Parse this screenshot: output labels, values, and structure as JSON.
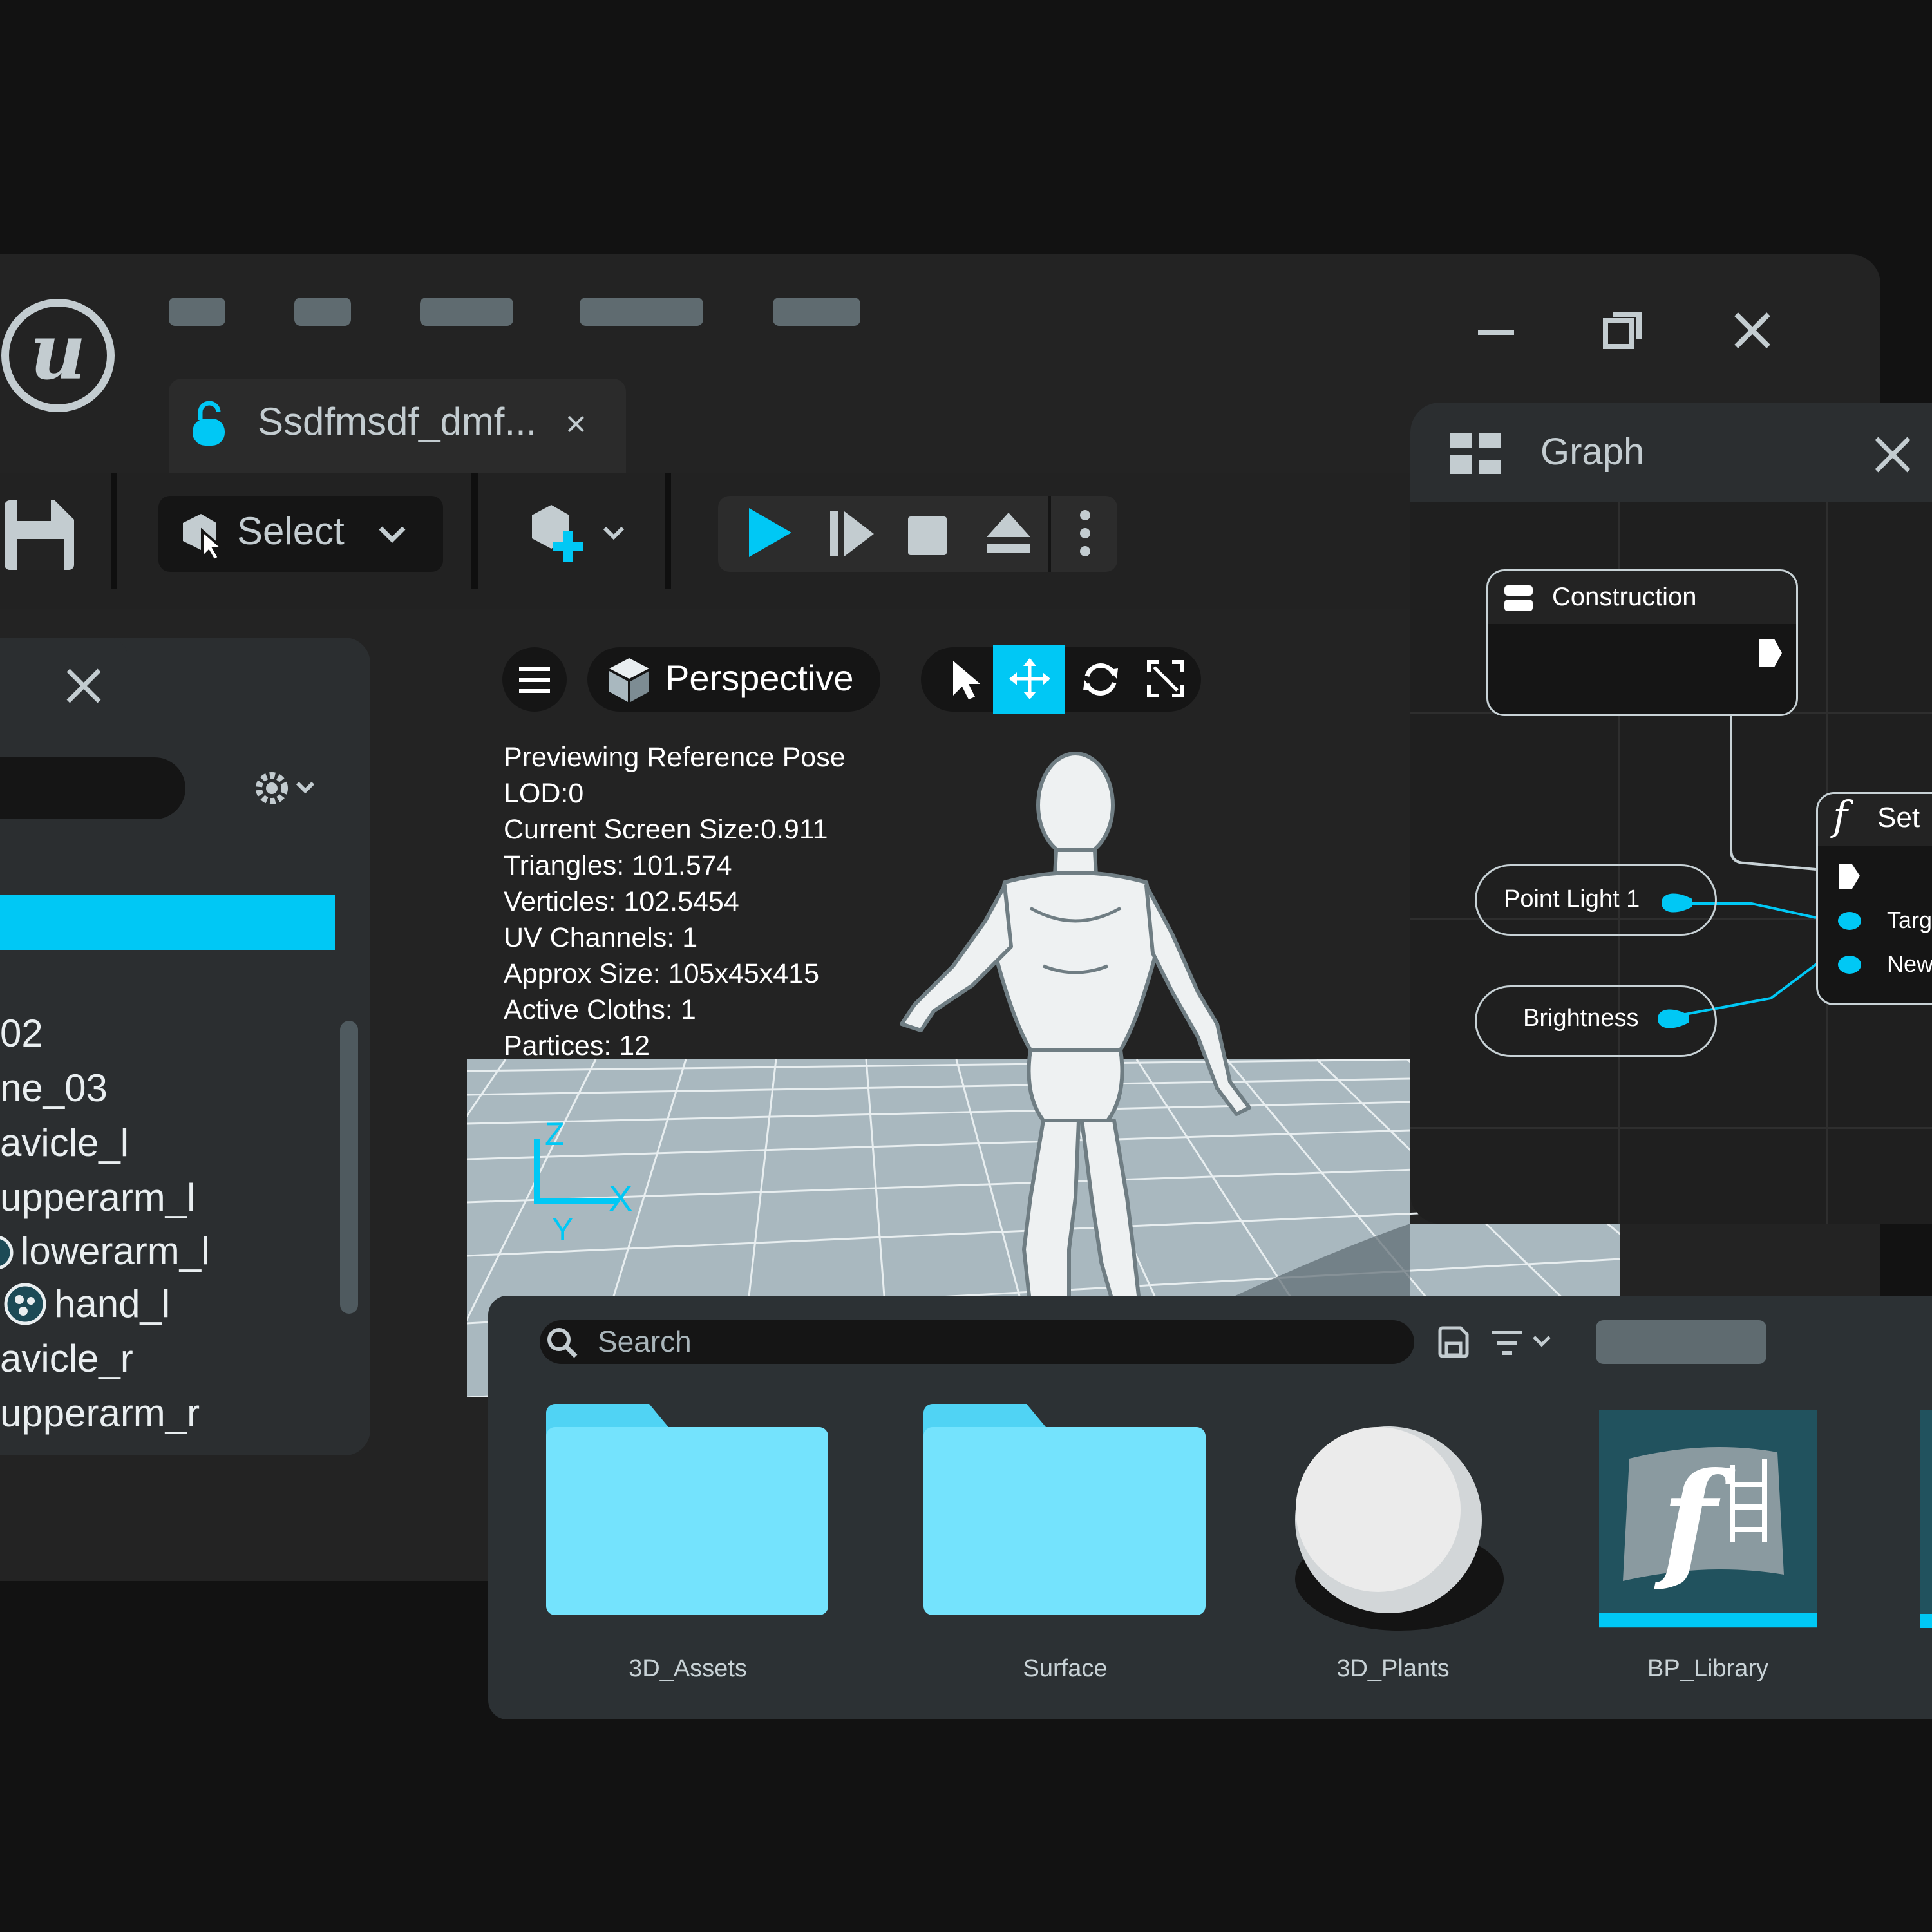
{
  "menu": {
    "items": [
      "",
      "",
      "",
      "",
      ""
    ]
  },
  "window": {
    "minimize": "minimize",
    "restore": "restore",
    "close": "close"
  },
  "tab": {
    "title": "Ssdfmsdf_dmf...",
    "close": "×"
  },
  "toolbar": {
    "select_label": "Select"
  },
  "viewport": {
    "view_mode": "Perspective",
    "stats": [
      "Previewing Reference Pose",
      "LOD:0",
      "Current Screen Size:0.911",
      "Triangles: 101.574",
      "Verticles: 102.5454",
      "UV Channels: 1",
      "Approx Size: 105x45x415",
      "Active Cloths: 1",
      "Partices: 12"
    ],
    "axis": {
      "z": "Z",
      "x": "X",
      "y": "Y"
    }
  },
  "outliner": {
    "items": [
      "02",
      "ne_03",
      "avicle_l",
      "upperarm_l",
      "lowerarm_l",
      "hand_l",
      "avicle_r",
      "upperarm_r"
    ]
  },
  "graph": {
    "title": "Graph",
    "construction": "Construction",
    "set_node": "Set",
    "set_pins": [
      "Targ",
      "New"
    ],
    "point_light": "Point Light 1",
    "brightness": "Brightness"
  },
  "browser": {
    "search_placeholder": "Search",
    "items": [
      {
        "label": "3D_Assets",
        "kind": "folder"
      },
      {
        "label": "Surface",
        "kind": "folder"
      },
      {
        "label": "3D_Plants",
        "kind": "sphere"
      },
      {
        "label": "BP_Library",
        "kind": "function"
      }
    ]
  },
  "colors": {
    "accent": "#00c8f5",
    "panel": "#2c3134",
    "folder": "#74e3fd"
  }
}
